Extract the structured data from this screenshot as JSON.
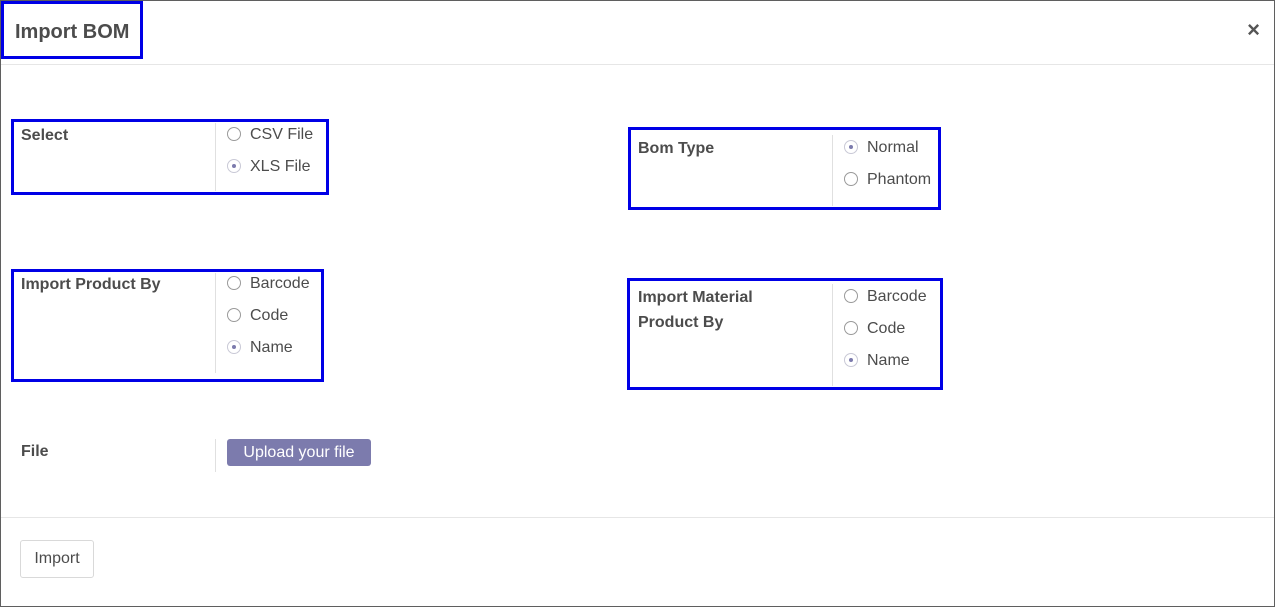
{
  "dialog": {
    "title": "Import BOM",
    "close_glyph": "×"
  },
  "select": {
    "label": "Select",
    "options": [
      {
        "label": "CSV File",
        "selected": false
      },
      {
        "label": "XLS File",
        "selected": true
      }
    ]
  },
  "bom_type": {
    "label": "Bom Type",
    "options": [
      {
        "label": "Normal",
        "selected": true
      },
      {
        "label": "Phantom",
        "selected": false
      }
    ]
  },
  "import_product_by": {
    "label": "Import Product By",
    "options": [
      {
        "label": "Barcode",
        "selected": false
      },
      {
        "label": "Code",
        "selected": false
      },
      {
        "label": "Name",
        "selected": true
      }
    ]
  },
  "import_material_product_by": {
    "label_line1": "Import Material",
    "label_line2": "Product By",
    "options": [
      {
        "label": "Barcode",
        "selected": false
      },
      {
        "label": "Code",
        "selected": false
      },
      {
        "label": "Name",
        "selected": true
      }
    ]
  },
  "file": {
    "label": "File",
    "upload_label": "Upload your file"
  },
  "footer": {
    "import_label": "Import"
  },
  "colors": {
    "highlight": "#0000e6",
    "accent": "#7c7bad"
  }
}
